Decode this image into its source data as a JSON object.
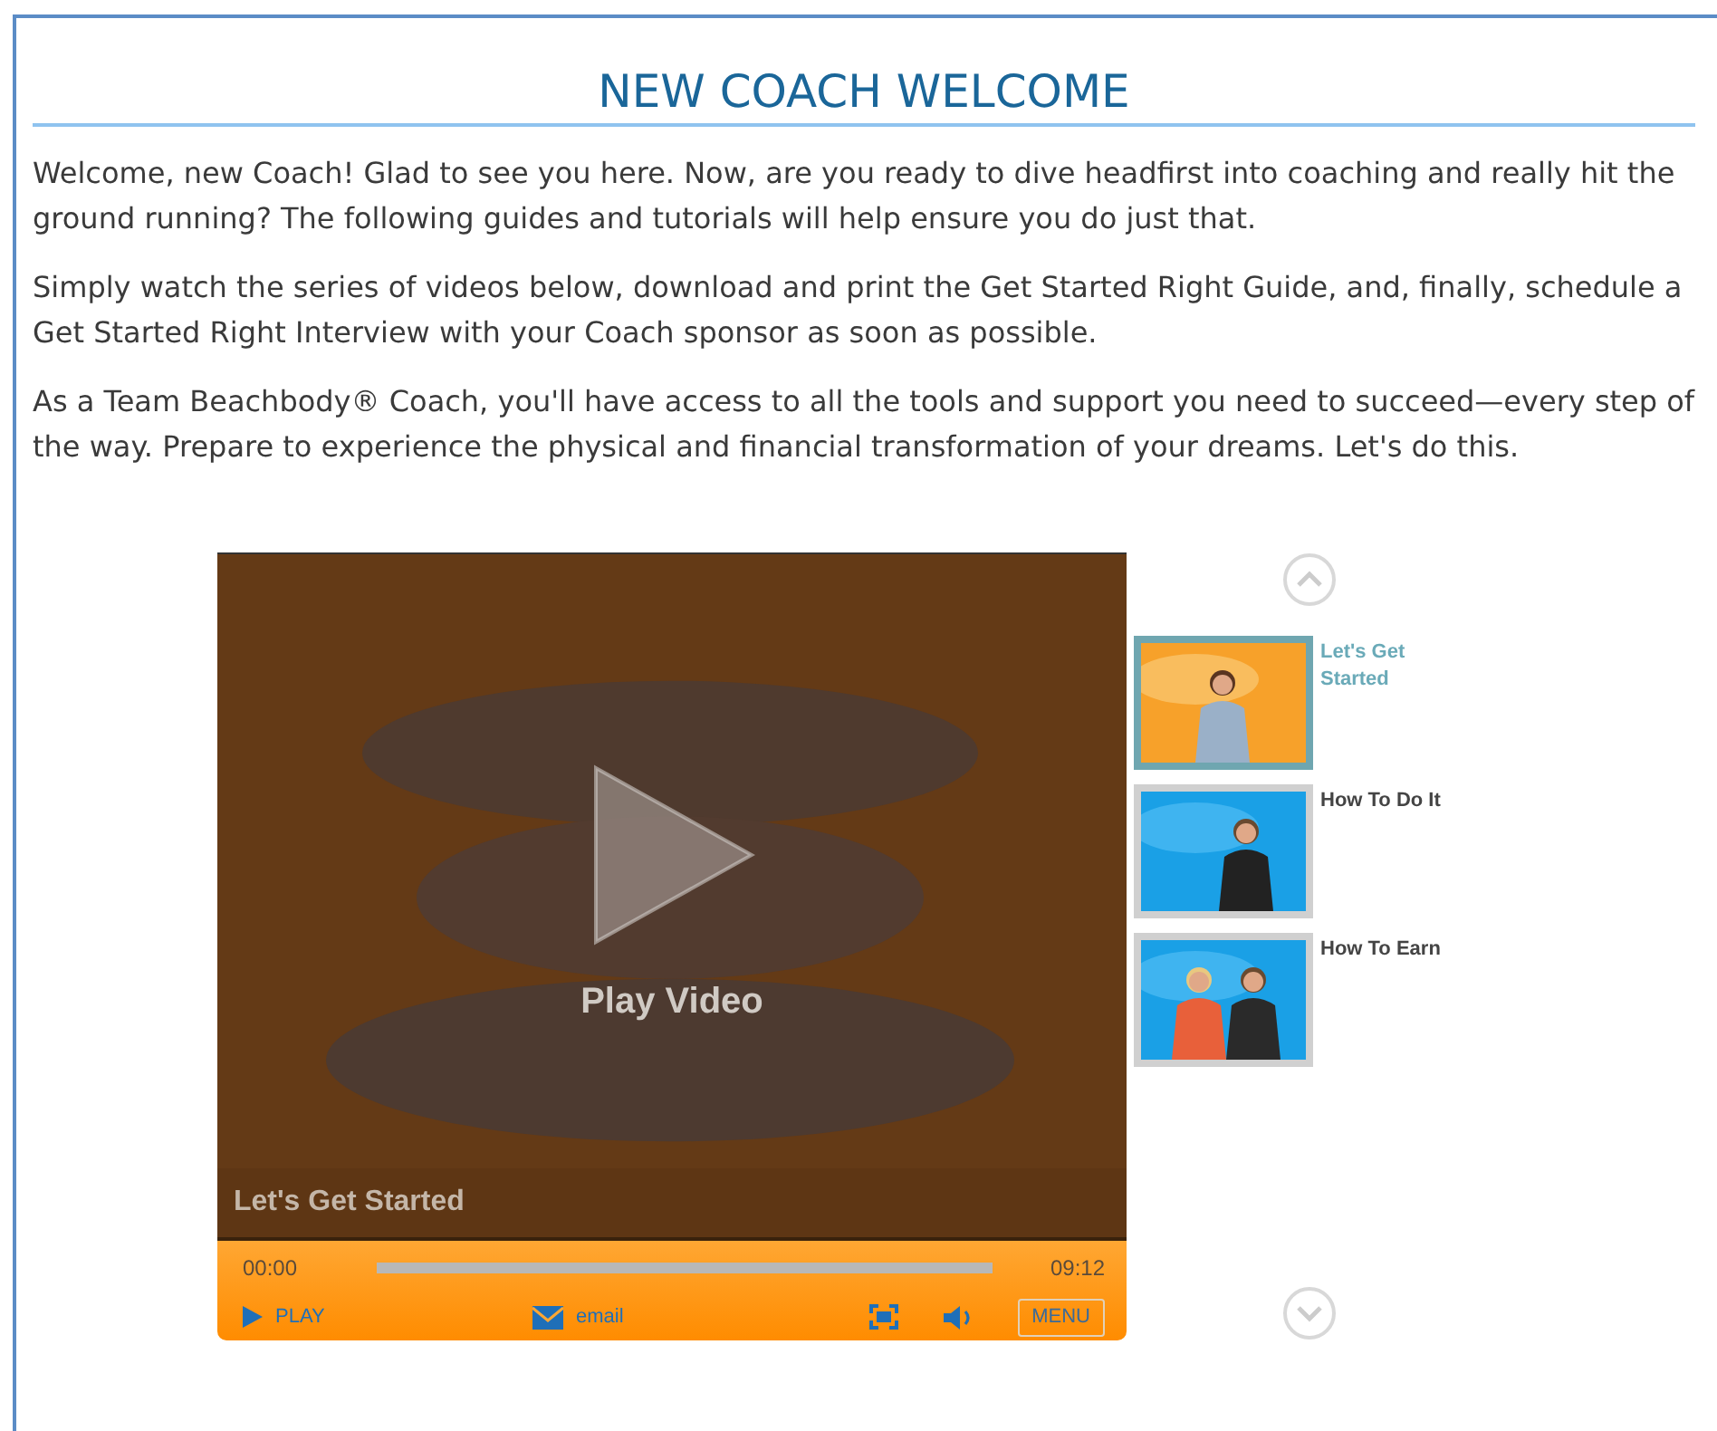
{
  "title": "NEW COACH WELCOME",
  "paragraphs": [
    "Welcome, new Coach! Glad to see you here. Now, are you ready to dive headfirst into coaching and really hit the ground running? The following guides and tutorials will help ensure you do just that.",
    "Simply watch the series of videos below, download and print the Get Started Right Guide, and, finally, schedule a Get Started Right Interview with your Coach sponsor as soon as possible.",
    "As a Team Beachbody® Coach, you'll have access to all the tools and support you need to succeed—every step of the way. Prepare to experience the physical and financial transformation of your dreams. Let's do this."
  ],
  "player": {
    "overlay_label": "Play Video",
    "caption": "Let's Get Started",
    "elapsed": "00:00",
    "duration": "09:12",
    "play_label": "PLAY",
    "email_label": "email",
    "menu_label": "MENU"
  },
  "playlist": [
    {
      "title": "Let's Get Started",
      "selected": true
    },
    {
      "title": "How To Do It",
      "selected": false
    },
    {
      "title": "How To Earn",
      "selected": false
    }
  ]
}
